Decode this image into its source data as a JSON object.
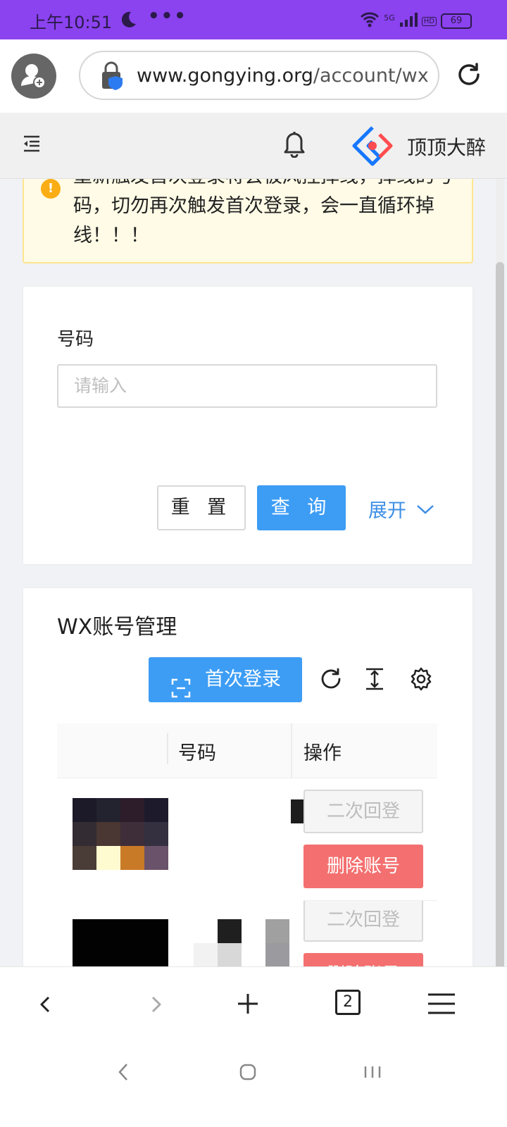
{
  "status_bar": {
    "time": "上午10:51",
    "dots": "•••",
    "network": "5G",
    "hd": "HD",
    "battery": "69"
  },
  "url_bar": {
    "domain": "www.gongying.org",
    "path": "/account/wx"
  },
  "header": {
    "user_name": "顶顶大醉"
  },
  "alert": {
    "text": "重新触发首次登录将会被风控掉线，掉线的号码，切勿再次触发首次登录，会一直循环掉线！！！"
  },
  "search": {
    "field_label": "号码",
    "placeholder": "请输入",
    "reset_label": "重 置",
    "query_label": "查 询",
    "expand_label": "展开"
  },
  "table": {
    "title": "WX账号管理",
    "first_login_label": "首次登录",
    "columns": [
      "号码",
      "操作"
    ],
    "rows": [
      {
        "relogin_label": "二次回登",
        "delete_label": "删除账号"
      },
      {
        "relogin_label": "二次回登",
        "delete_label": "删除账号"
      }
    ]
  },
  "browser_nav": {
    "tab_count": "2"
  },
  "colors": {
    "status_bar": "#8b42ef",
    "primary": "#3d9df5",
    "danger": "#f47070",
    "warning_bg": "#fffbe6",
    "warning_border": "#ffe58f"
  }
}
